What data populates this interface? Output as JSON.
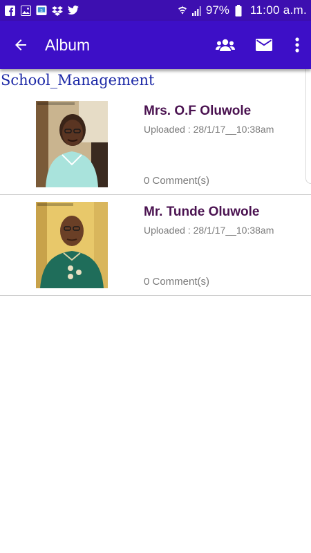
{
  "status_bar": {
    "battery": "97%",
    "time": "11:00 a.m.",
    "left_icons": [
      "facebook-icon",
      "gallery-icon",
      "screenshot-app-icon",
      "dropbox-icon",
      "twitter-icon"
    ],
    "right_icons": [
      "wifi-icon",
      "signal-icon",
      "battery-icon"
    ]
  },
  "app_bar": {
    "title": "Album",
    "actions": [
      "group-icon",
      "mail-icon",
      "more-vert-icon"
    ],
    "color": "#3d0fc7"
  },
  "section": {
    "title": "School_Management"
  },
  "albums": [
    {
      "name": "Mrs. O.F Oluwole",
      "uploaded": "Uploaded : 28/1/17__10:38am",
      "comments": "0 Comment(s)"
    },
    {
      "name": "Mr. Tunde Oluwole",
      "uploaded": "Uploaded : 28/1/17__10:38am",
      "comments": "0 Comment(s)"
    }
  ]
}
